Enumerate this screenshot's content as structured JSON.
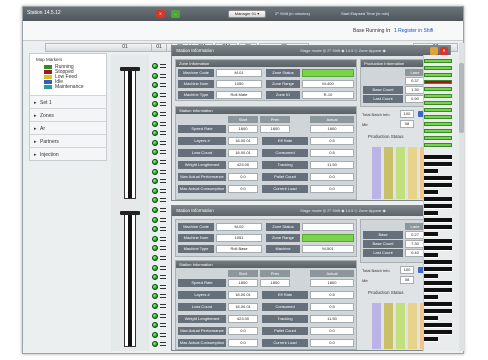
{
  "window": {
    "title": "Station 14.5.12",
    "close": "X",
    "minimize": "–",
    "dropdown": "Manager 01",
    "link1": "2⁰ Shift (in minutes)",
    "link2": "Start Elapsed Time (in min)"
  },
  "toolbar": {
    "status_label": "Base Running In",
    "status_value": "1 Register in Shift"
  },
  "columns": [
    "01",
    "01",
    "28",
    "FM",
    "CM",
    "23",
    "02",
    "07"
  ],
  "legend": {
    "title": "Map Markers",
    "items": [
      {
        "label": "Running",
        "color": "#2e8b2e"
      },
      {
        "label": "Stopped",
        "color": "#a01818"
      },
      {
        "label": "Low Feed",
        "color": "#d9c21c"
      },
      {
        "label": "Idle",
        "color": "#2b5ed6"
      },
      {
        "label": "Maintenance",
        "color": "#2a9a9a"
      }
    ],
    "sections": [
      "Set 1",
      "Zones",
      "Ar",
      "Partners",
      "Injection"
    ]
  },
  "panel1": {
    "title": "Station Information",
    "title_right": "Stage mode ◎ 2⁰ Shift ◆ 14.5 ◇ Zone Appear ◆",
    "top_left_header": "Zone Information",
    "fields": [
      {
        "label": "Machine Code",
        "value": "M-01"
      },
      {
        "label": "Machine Num",
        "value": "1050"
      },
      {
        "label": "Machine Type",
        "value": "Roll Mate"
      }
    ],
    "fields_right": [
      {
        "label": "Zone Status",
        "value": ""
      },
      {
        "label": "Zone Range",
        "value": "M-400"
      },
      {
        "label": "Zone ID",
        "value": "R-10"
      }
    ],
    "right_header": "Production Information",
    "right_cols": [
      "Lane",
      "Rate"
    ],
    "right_rows": [
      {
        "label": "",
        "a": "0.37",
        "b": "0.64"
      },
      {
        "label": "Base Count",
        "a": "1.30",
        "b": "0.50"
      },
      {
        "label": "Last Count",
        "a": "0.90",
        "b": "0.80"
      }
    ],
    "total_label": "Total Batch Info",
    "total_value": "100",
    "total_label2": "Min",
    "total_value2": "08",
    "production_header": "Production Information",
    "production_title": "Production Status",
    "bottom_header": "Station Information",
    "bottom_cols": [
      "Start",
      "Prev",
      "Actual"
    ],
    "bottom_rows": [
      {
        "label": "Speed Rate",
        "a": "1800",
        "b": "1800",
        "c": "1800",
        "label2": "",
        "d": ""
      },
      {
        "label": "Layers #",
        "a": "18.00.01",
        "b": "",
        "c": "",
        "label2": "Eff Rate",
        "d": "0.5"
      },
      {
        "label": "Loss Count",
        "a": "18.00.01",
        "b": "",
        "c": "",
        "label2": "Consumed",
        "d": "0.5"
      },
      {
        "label": "Weight Lengthened",
        "a": "423.00",
        "b": "",
        "c": "",
        "label2": "Tracking",
        "d": "11.50"
      },
      {
        "label": "Max Actual Performance",
        "a": "0.0",
        "b": "",
        "c": "",
        "label2": "Pallet Count",
        "d": "0.0"
      },
      {
        "label": "Max Actual Consumption",
        "a": "0.0",
        "b": "",
        "c": "",
        "label2": "Current Load",
        "d": "0.0"
      }
    ]
  },
  "panel2": {
    "title": "Station Information",
    "title_right": "Stage mode ◎ 2⁰ Shift ◆ 14.5 ◇ Zone Appear ◆",
    "fields": [
      {
        "label": "Machine Code",
        "value": "M-02"
      },
      {
        "label": "Machine Num",
        "value": "1051"
      },
      {
        "label": "Machine Type",
        "value": "Roll Base"
      }
    ],
    "fields_right": [
      {
        "label": "Zone Status",
        "value": ""
      },
      {
        "label": "Zone Range",
        "value": ""
      },
      {
        "label": "Machine",
        "value": "M-501"
      }
    ],
    "right_header": "Production Information",
    "right_cols": [
      "Lane",
      "Rate"
    ],
    "right_rows": [
      {
        "label": "Base",
        "a": "0.27",
        "b": "0.56"
      },
      {
        "label": "Base Count",
        "a": "7.30",
        "b": "0.60"
      },
      {
        "label": "Last Count",
        "a": "0.40",
        "b": "0.70"
      }
    ],
    "total_label": "Total Batch Info",
    "total_value": "100",
    "total_label2": "Min",
    "total_value2": "08",
    "production_title": "Production Status",
    "bottom_header": "Station Information",
    "bottom_cols": [
      "Start",
      "Prev",
      "Actual"
    ],
    "bottom_rows": [
      {
        "label": "Speed Rate",
        "a": "1800",
        "b": "1800",
        "c": "1800",
        "label2": "",
        "d": ""
      },
      {
        "label": "Layers #",
        "a": "18.00.01",
        "b": "",
        "c": "",
        "label2": "Eff Rate",
        "d": "0.5"
      },
      {
        "label": "Loss Count",
        "a": "18.00.01",
        "b": "",
        "c": "",
        "label2": "Consumed",
        "d": "0.5"
      },
      {
        "label": "Weight Lengthened",
        "a": "423.00",
        "b": "",
        "c": "",
        "label2": "Tracking",
        "d": "11.50"
      },
      {
        "label": "Max Actual Performance",
        "a": "0.0",
        "b": "",
        "c": "",
        "label2": "Pallet Count",
        "d": "0.0"
      },
      {
        "label": "Max Actual Consumption",
        "a": "0.0",
        "b": "",
        "c": "",
        "label2": "Current Load",
        "d": "0.0"
      }
    ]
  },
  "colors": {
    "green": "#7bd24b",
    "dark_header": "#65707a",
    "panel_bg": "#dfe3e5",
    "bars": [
      "#b9b3e6",
      "#c9c06a",
      "#c3e07e",
      "#e8d38a",
      "#f2c38a",
      "#e6e6e6"
    ]
  }
}
